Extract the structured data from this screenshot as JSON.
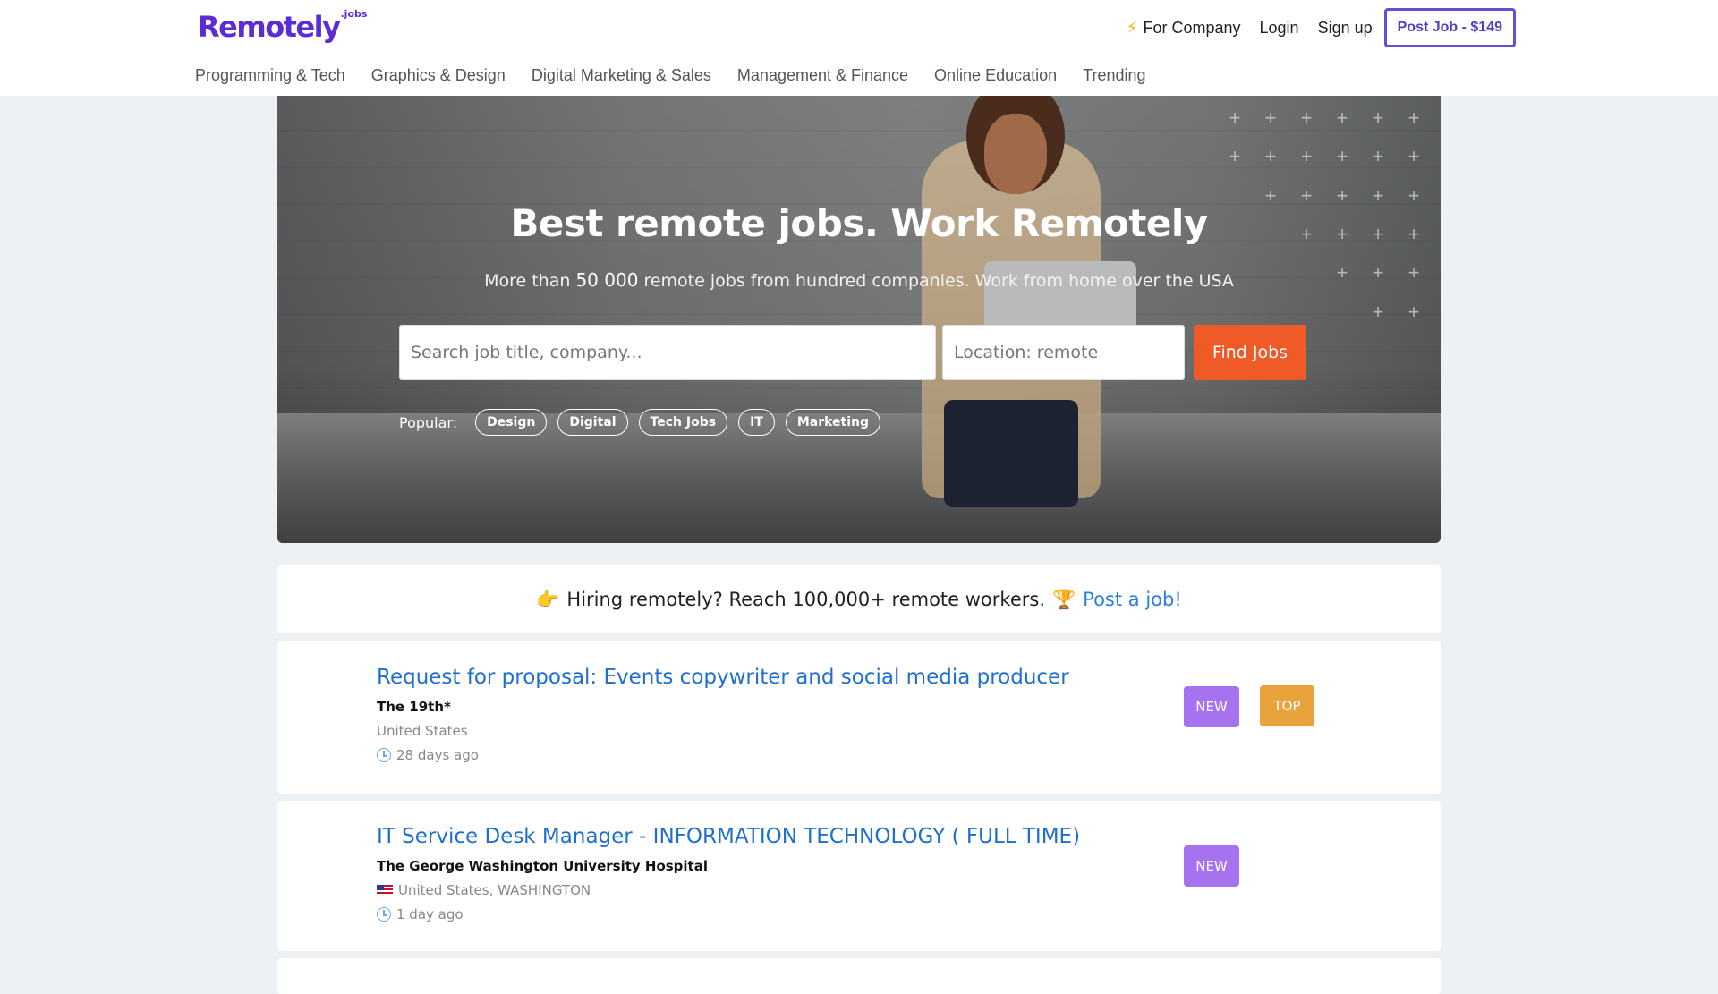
{
  "header": {
    "logo_text": "Remotely",
    "logo_sup": ".jobs",
    "for_company_icon": "lightning-bolt-icon",
    "for_company_label": "For Company",
    "login_label": "Login",
    "signup_label": "Sign up",
    "post_job_label": "Post Job - $149",
    "accent_color": "#5b2bd6"
  },
  "categories": [
    "Programming & Tech",
    "Graphics & Design",
    "Digital Marketing & Sales",
    "Management & Finance",
    "Online Education",
    "Trending"
  ],
  "hero": {
    "title": "Best remote jobs. Work Remotely",
    "subtitle_pre": "More than ",
    "subtitle_count": "50 000",
    "subtitle_post": " remote jobs from hundred companies. Work from home over the USA",
    "search_placeholder": "Search job title, company...",
    "location_placeholder": "Location: remote",
    "find_button": "Find Jobs",
    "find_button_color": "#ef5a26",
    "popular_label": "Popular:",
    "popular_tags": [
      "Design",
      "Digital",
      "Tech Jobs",
      "IT",
      "Marketing"
    ]
  },
  "promo": {
    "icon_left": "👉",
    "text": "Hiring remotely? Reach 100,000+ remote workers.",
    "icon_right": "🏆",
    "link_text": "Post a job!"
  },
  "jobs": [
    {
      "title": "Request for proposal: Events copywriter and social media producer",
      "company": "The 19th*",
      "location": "United States",
      "time": "28 days ago",
      "badges": [
        "NEW",
        "TOP"
      ]
    },
    {
      "title": "IT Service Desk Manager - INFORMATION TECHNOLOGY ( FULL TIME)",
      "company": "The George Washington University Hospital",
      "location": "United States, WASHINGTON",
      "flag_icon": "us-flag-icon",
      "time": "1 day ago",
      "badges": [
        "NEW"
      ]
    }
  ]
}
